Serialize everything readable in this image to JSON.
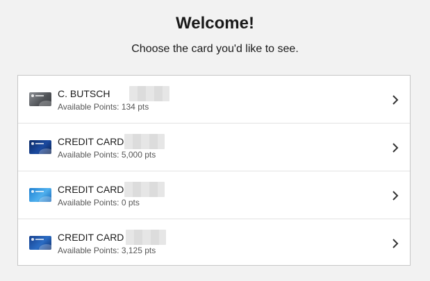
{
  "header": {
    "title": "Welcome!",
    "subtitle": "Choose the card you'd like to see."
  },
  "cards": [
    {
      "name": "C. BUTSCH",
      "points": "Available Points: 134 pts",
      "thumbnail": "gray-card-icon"
    },
    {
      "name": "CREDIT CARD",
      "points": "Available Points: 5,000 pts",
      "thumbnail": "navy-card-icon"
    },
    {
      "name": "CREDIT CARD",
      "points": "Available Points: 0 pts",
      "thumbnail": "blue-card-icon"
    },
    {
      "name": "CREDIT CARD",
      "points": "Available Points: 3,125 pts",
      "thumbnail": "navy-card-icon"
    }
  ],
  "colors": {
    "background": "#f2f2f2",
    "panel": "#ffffff",
    "border": "#c6c6c6",
    "text": "#1a1a1a",
    "muted_text": "#555555",
    "chevron": "#333333"
  }
}
